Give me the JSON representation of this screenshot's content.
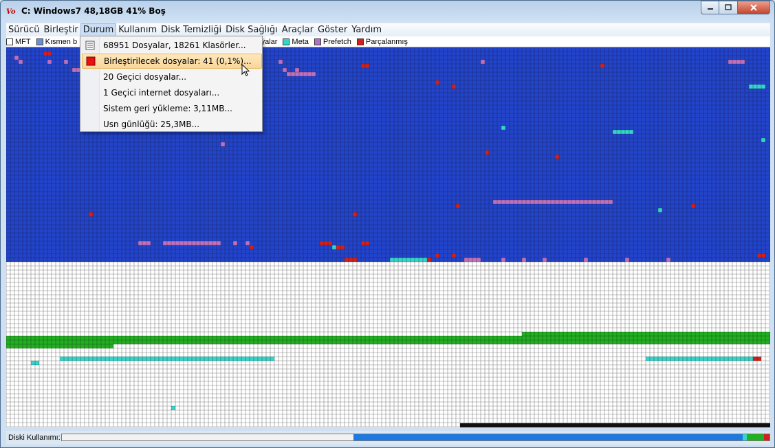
{
  "window": {
    "title": "C: Windows7  48,18GB 41% Boş",
    "logo_icon": "app-logo-icon"
  },
  "menubar": {
    "items": [
      "Sürücü",
      "Birleştir",
      "Durum",
      "Kullanım",
      "Disk Temizliği",
      "Disk Sağlığı",
      "Araçlar",
      "Göster",
      "Yardım"
    ],
    "active_index": 2
  },
  "legend": [
    {
      "label": "MFT",
      "color": "#ffffff"
    },
    {
      "label": "Kısmen b",
      "color": "#6a8fd8"
    },
    {
      "label": "syalar",
      "color": "#2244cc"
    },
    {
      "label": "Meta",
      "color": "#33d6cc"
    },
    {
      "label": "Prefetch",
      "color": "#b070c8"
    },
    {
      "label": "Parçalanmış",
      "color": "#d02020"
    }
  ],
  "dropdown": {
    "items": [
      {
        "label": "68951 Dosyalar, 18261 Klasörler...",
        "icon": "list-icon"
      },
      {
        "label": "Birleştirilecek dosyalar:  41 (0,1%)...",
        "icon": "red-square-icon",
        "highlighted": true
      },
      {
        "label": "20 Geçici dosyalar...",
        "icon": ""
      },
      {
        "label": "1 Geçici internet dosyaları...",
        "icon": ""
      },
      {
        "label": "Sistem geri yükleme: 3,11MB...",
        "icon": ""
      },
      {
        "label": "Usn günlüğü: 25,3MB...",
        "icon": ""
      }
    ]
  },
  "status": {
    "label": "Diski Kullanımı:",
    "usage_segments": [
      {
        "color": "#f2f2f2",
        "fraction": 0.412
      },
      {
        "color": "#1e7ae0",
        "fraction": 0.55
      },
      {
        "color": "#33d6cc",
        "fraction": 0.006
      },
      {
        "color": "#20b020",
        "fraction": 0.024
      },
      {
        "color": "#d02020",
        "fraction": 0.008
      }
    ]
  },
  "colors": {
    "used": "#2244cc",
    "free": "#ffffff",
    "grid": "#1a1a1a",
    "system": "#20b020",
    "meta": "#33d6cc",
    "pagefile": "#c070c0",
    "fragmented": "#d02020"
  }
}
